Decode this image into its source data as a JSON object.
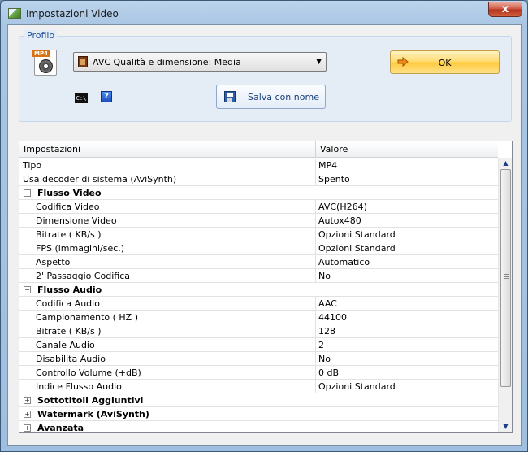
{
  "window": {
    "title": "Impostazioni Video",
    "close_label": "x"
  },
  "profile": {
    "group_label": "Profilo",
    "mp4_label": "MP4",
    "selected_profile": "AVC Qualità e dimensione: Media",
    "ok_label": "OK",
    "cmd_label": "C:\\",
    "help_label": "?",
    "save_as_label": "Salva con nome"
  },
  "grid": {
    "columns": [
      "Impostazioni",
      "Valore"
    ],
    "rows": [
      {
        "type": "row",
        "name": "Tipo",
        "value": "MP4"
      },
      {
        "type": "row",
        "name": "Usa decoder di sistema (AviSynth)",
        "value": "Spento"
      },
      {
        "type": "cat",
        "name": "Flusso Video",
        "toggle": "−"
      },
      {
        "type": "sub",
        "name": "Codifica Video",
        "value": "AVC(H264)"
      },
      {
        "type": "sub",
        "name": "Dimensione Video",
        "value": "Autox480"
      },
      {
        "type": "sub",
        "name": "Bitrate ( KB/s )",
        "value": "Opzioni Standard"
      },
      {
        "type": "sub",
        "name": "FPS (immagini/sec.)",
        "value": "Opzioni Standard"
      },
      {
        "type": "sub",
        "name": "Aspetto",
        "value": "Automatico"
      },
      {
        "type": "sub",
        "name": "2' Passaggio Codifica",
        "value": "No"
      },
      {
        "type": "cat",
        "name": "Flusso Audio",
        "toggle": "−"
      },
      {
        "type": "sub",
        "name": "Codifica Audio",
        "value": "AAC"
      },
      {
        "type": "sub",
        "name": "Campionamento ( HZ )",
        "value": "44100"
      },
      {
        "type": "sub",
        "name": "Bitrate ( KB/s )",
        "value": "128"
      },
      {
        "type": "sub",
        "name": "Canale Audio",
        "value": "2"
      },
      {
        "type": "sub",
        "name": "Disabilita Audio",
        "value": "No"
      },
      {
        "type": "sub",
        "name": "Controllo Volume (+dB)",
        "value": "0 dB"
      },
      {
        "type": "sub",
        "name": "Indice Flusso Audio",
        "value": "Opzioni Standard"
      },
      {
        "type": "cat",
        "name": "Sottotitoli Aggiuntivi",
        "toggle": "+"
      },
      {
        "type": "cat",
        "name": "Watermark (AviSynth)",
        "toggle": "+"
      },
      {
        "type": "cat",
        "name": "Avanzata",
        "toggle": "+"
      }
    ]
  }
}
